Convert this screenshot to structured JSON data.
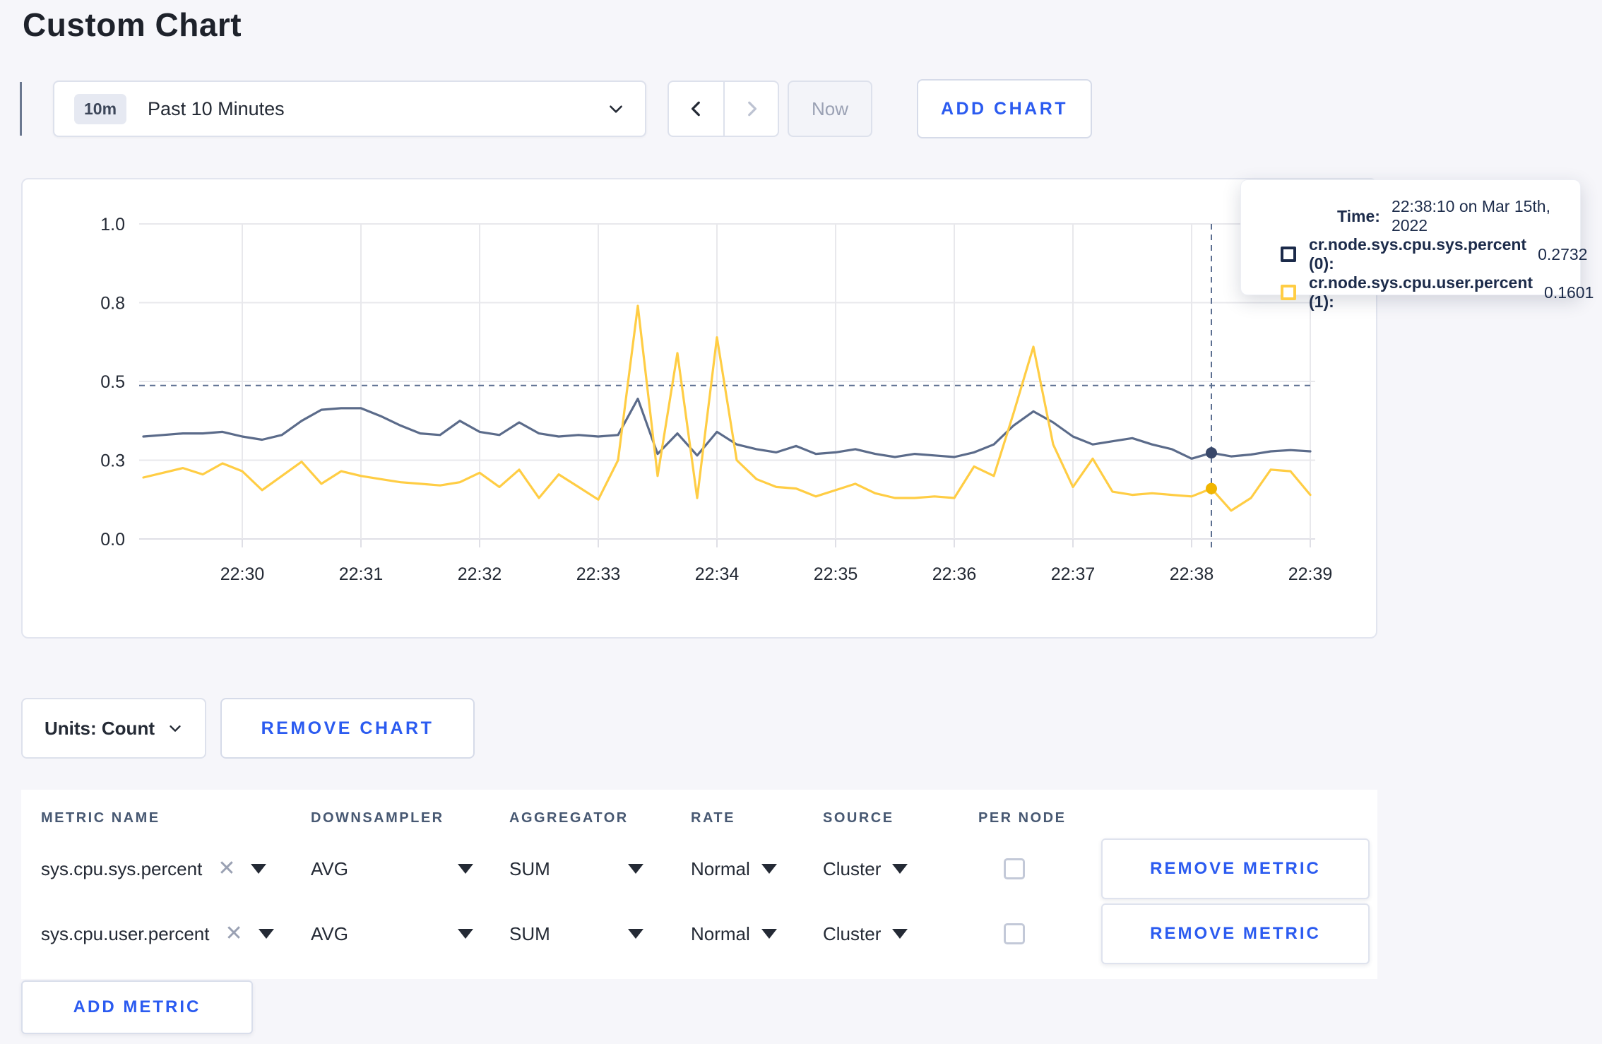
{
  "page": {
    "title": "Custom Chart",
    "background": "#f6f6fa",
    "accent_blue": "#2b5bf0"
  },
  "toolbar": {
    "time_badge": "10m",
    "time_label": "Past 10 Minutes",
    "now_label": "Now",
    "add_chart_label": "ADD CHART"
  },
  "chart_data": {
    "type": "line",
    "title": "",
    "xlabel": "",
    "ylabel": "",
    "ylim": [
      0,
      1
    ],
    "grid": true,
    "x_tick_labels": [
      "22:30",
      "22:31",
      "22:32",
      "22:33",
      "22:34",
      "22:35",
      "22:36",
      "22:37",
      "22:38",
      "22:39"
    ],
    "y_tick_labels": [
      "1.0",
      "0.8",
      "0.5",
      "0.3",
      "0.0"
    ],
    "y_tick_values": [
      1.0,
      0.75,
      0.5,
      0.25,
      0.0
    ],
    "x_start": "22:29:10",
    "x_step_seconds": 10,
    "series": [
      {
        "name": "cr.node.sys.cpu.sys.percent",
        "color": "#5b6b8a",
        "dot_color": "#39486a",
        "values": [
          0.325,
          0.33,
          0.335,
          0.335,
          0.34,
          0.325,
          0.315,
          0.33,
          0.375,
          0.41,
          0.415,
          0.415,
          0.39,
          0.36,
          0.335,
          0.33,
          0.375,
          0.34,
          0.33,
          0.37,
          0.335,
          0.325,
          0.33,
          0.325,
          0.33,
          0.445,
          0.27,
          0.335,
          0.265,
          0.34,
          0.3,
          0.285,
          0.275,
          0.295,
          0.27,
          0.275,
          0.285,
          0.27,
          0.26,
          0.27,
          0.265,
          0.26,
          0.275,
          0.3,
          0.36,
          0.405,
          0.37,
          0.325,
          0.3,
          0.31,
          0.32,
          0.3,
          0.285,
          0.255,
          0.2732,
          0.262,
          0.268,
          0.278,
          0.282,
          0.278
        ]
      },
      {
        "name": "cr.node.sys.cpu.user.percent",
        "color": "#ffcd44",
        "dot_color": "#f0b500",
        "values": [
          0.195,
          0.21,
          0.225,
          0.205,
          0.24,
          0.215,
          0.155,
          0.2,
          0.245,
          0.175,
          0.215,
          0.2,
          0.19,
          0.18,
          0.175,
          0.17,
          0.18,
          0.21,
          0.165,
          0.22,
          0.13,
          0.205,
          0.165,
          0.125,
          0.25,
          0.74,
          0.2,
          0.59,
          0.13,
          0.64,
          0.25,
          0.19,
          0.165,
          0.16,
          0.135,
          0.155,
          0.175,
          0.145,
          0.13,
          0.13,
          0.135,
          0.13,
          0.23,
          0.2,
          0.4,
          0.61,
          0.3,
          0.165,
          0.255,
          0.15,
          0.14,
          0.145,
          0.14,
          0.135,
          0.1601,
          0.09,
          0.13,
          0.22,
          0.215,
          0.14
        ]
      }
    ],
    "crosshair": {
      "x_index": 54,
      "x_label": "22:38:10",
      "y_value": 0.487,
      "series_values": [
        0.2732,
        0.1601
      ]
    },
    "legend_position": "tooltip"
  },
  "tooltip": {
    "time_label": "Time:",
    "time_value": "22:38:10 on Mar 15th, 2022",
    "rows": [
      {
        "label": "cr.node.sys.cpu.sys.percent (0):",
        "value": "0.2732",
        "color": "#1b2a4a"
      },
      {
        "label": "cr.node.sys.cpu.user.percent (1):",
        "value": "0.1601",
        "color": "#ffcd44"
      }
    ]
  },
  "chart_footer": {
    "units_label": "Units: Count",
    "remove_chart_label": "REMOVE CHART"
  },
  "metrics": {
    "headers": [
      "METRIC NAME",
      "DOWNSAMPLER",
      "AGGREGATOR",
      "RATE",
      "SOURCE",
      "PER NODE"
    ],
    "rows": [
      {
        "metric": "sys.cpu.sys.percent",
        "downsampler": "AVG",
        "aggregator": "SUM",
        "rate": "Normal",
        "source": "Cluster",
        "per_node": false,
        "remove_label": "REMOVE METRIC"
      },
      {
        "metric": "sys.cpu.user.percent",
        "downsampler": "AVG",
        "aggregator": "SUM",
        "rate": "Normal",
        "source": "Cluster",
        "per_node": false,
        "remove_label": "REMOVE METRIC"
      }
    ],
    "add_metric_label": "ADD METRIC"
  }
}
